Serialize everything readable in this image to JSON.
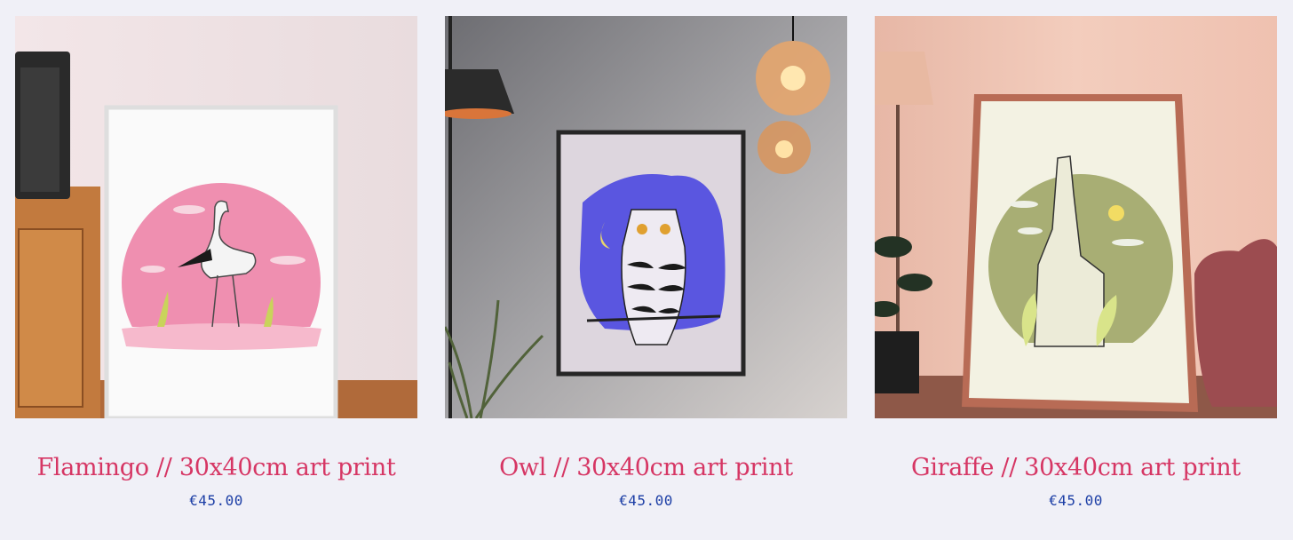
{
  "products": [
    {
      "title": "Flamingo // 30x40cm art print",
      "price": "€45.00",
      "image_icon": "flamingo-print-photo"
    },
    {
      "title": "Owl // 30x40cm art print",
      "price": "€45.00",
      "image_icon": "owl-print-photo"
    },
    {
      "title": "Giraffe // 30x40cm art print",
      "price": "€45.00",
      "image_icon": "giraffe-print-photo"
    }
  ],
  "colors": {
    "background": "#f0f0f7",
    "title": "#d63664",
    "price": "#1d3fa6"
  }
}
